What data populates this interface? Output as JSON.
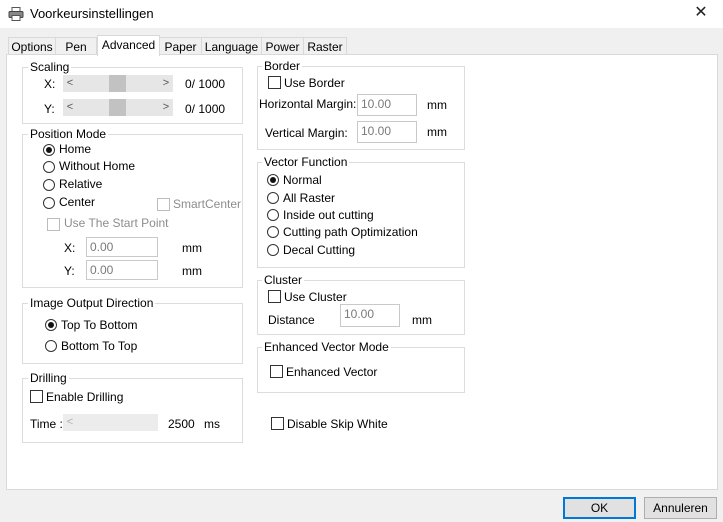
{
  "window": {
    "title": "Voorkeursinstellingen",
    "close_glyph": "✕",
    "icon": "printer-icon"
  },
  "tabs": [
    {
      "label": "Options"
    },
    {
      "label": "Pen"
    },
    {
      "label": "Advanced"
    },
    {
      "label": "Paper"
    },
    {
      "label": "Language"
    },
    {
      "label": "Power"
    },
    {
      "label": "Raster"
    }
  ],
  "active_tab": "Advanced",
  "scaling": {
    "title": "Scaling",
    "x_label": "X:",
    "x_value": "0/ 1000",
    "y_label": "Y:",
    "y_value": "0/ 1000"
  },
  "position_mode": {
    "title": "Position Mode",
    "home": "Home",
    "without_home": "Without Home",
    "relative": "Relative",
    "center": "Center",
    "smart_center": "SmartCenter",
    "use_start_point": "Use The Start Point",
    "x_label": "X:",
    "x_value": "0.00",
    "y_label": "Y:",
    "y_value": "0.00",
    "unit": "mm",
    "selected": "Home"
  },
  "image_output": {
    "title": "Image Output Direction",
    "top_to_bottom": "Top To Bottom",
    "bottom_to_top": "Bottom To Top",
    "selected": "Top To Bottom"
  },
  "drilling": {
    "title": "Drilling",
    "enable": "Enable Drilling",
    "time_label": "Time :",
    "time_value": "2500",
    "time_unit": "ms"
  },
  "border": {
    "title": "Border",
    "use_border": "Use Border",
    "h_margin_label": "Horizontal Margin:",
    "h_margin_value": "10.00",
    "v_margin_label": "Vertical Margin:",
    "v_margin_value": "10.00",
    "unit": "mm"
  },
  "vector_function": {
    "title": "Vector Function",
    "normal": "Normal",
    "all_raster": "All Raster",
    "inside_out": "Inside out cutting",
    "cutting_path": "Cutting path Optimization",
    "decal": "Decal Cutting",
    "selected": "Normal"
  },
  "cluster": {
    "title": "Cluster",
    "use_cluster": "Use Cluster",
    "distance_label": "Distance",
    "distance_value": "10.00",
    "unit": "mm"
  },
  "enhanced_vector_mode": {
    "title": "Enhanced Vector Mode",
    "enhanced_vector": "Enhanced Vector"
  },
  "disable_skip_white": "Disable Skip White",
  "buttons": {
    "ok": "OK",
    "cancel": "Annuleren"
  },
  "colors": {
    "accent": "#0078d7",
    "panel": "#ffffff",
    "background": "#f0f0f0"
  }
}
